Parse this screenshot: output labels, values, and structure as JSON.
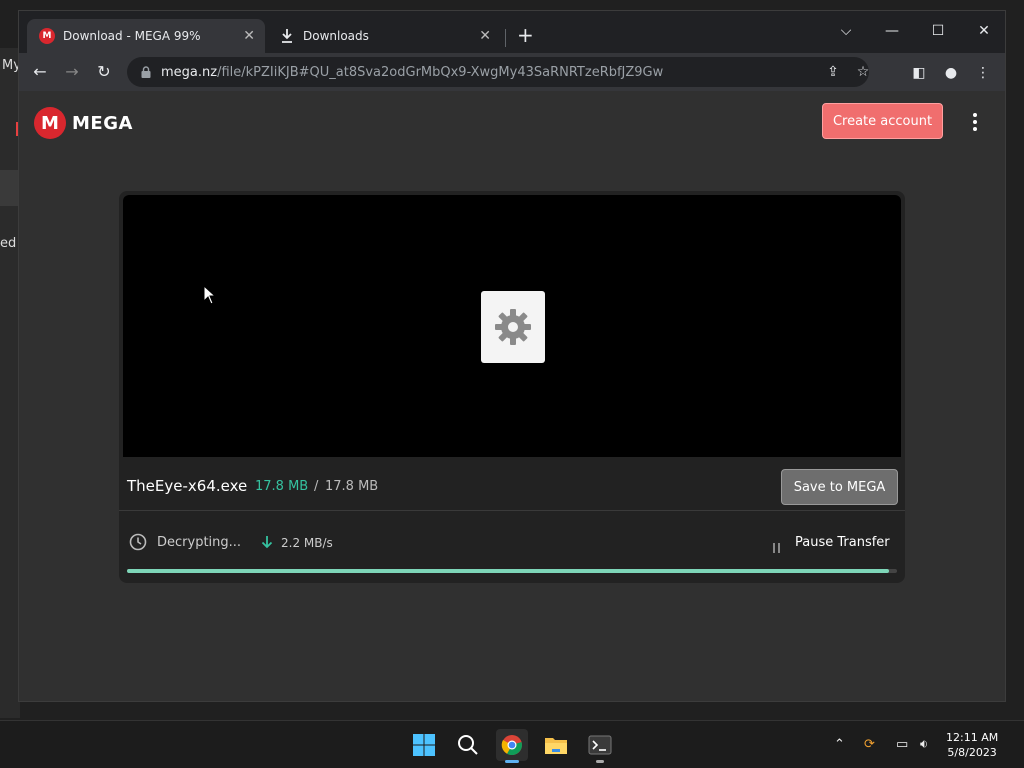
{
  "desktop": {
    "bg_text_1": "My",
    "bg_text_2": "ed"
  },
  "browser": {
    "tabs": [
      {
        "label": "Download - MEGA 99%",
        "active": true,
        "favicon": "mega-icon"
      },
      {
        "label": "Downloads",
        "active": false,
        "favicon": "download-icon"
      }
    ],
    "url_host": "mega.nz",
    "url_path": "/file/kPZIiKJB#QU_at8Sva2odGrMbQx9-XwgMy43SaRNRTzeRbfJZ9Gw"
  },
  "page": {
    "logo_letter": "M",
    "logo_text": "MEGA",
    "create_account": "Create account",
    "file_name": "TheEye-x64.exe",
    "size_done": "17.8 MB",
    "size_sep": "/",
    "size_total": "17.8 MB",
    "save_button": "Save to MEGA",
    "status": "Decrypting...",
    "speed": "2.2 MB/s",
    "pause_button": "Pause Transfer",
    "progress": 0.99,
    "accent": "#d9272e",
    "progress_color": "#7ed6b8"
  },
  "taskbar": {
    "time": "12:11 AM",
    "date": "5/8/2023"
  }
}
